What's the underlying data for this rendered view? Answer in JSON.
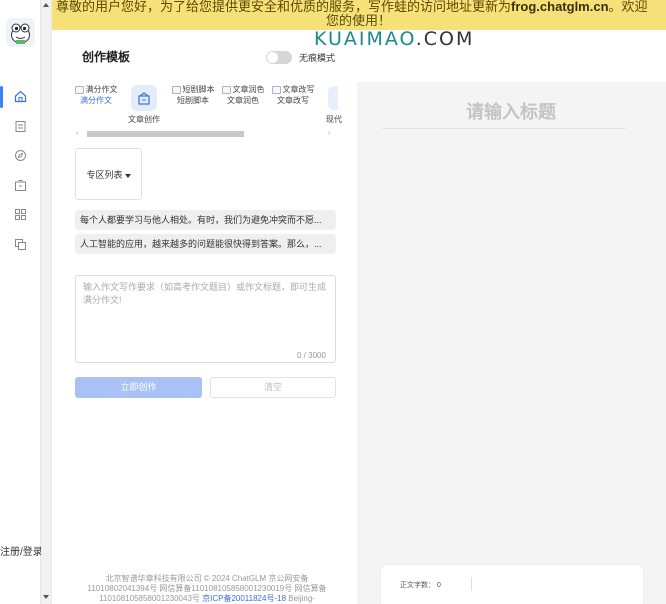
{
  "banner": {
    "text_prefix": "尊敬的用户您好，为了给您提供更安全和优质的服务，写作蛙的访问地址更新为",
    "domain": "frog.chatglm.cn",
    "text_suffix_1": "。欢迎",
    "text_suffix_2": "您的使用！"
  },
  "watermark": {
    "main": "KUAIMAO",
    "suffix": ".COM"
  },
  "sidebar": {
    "items": [
      {
        "icon": "home-icon"
      },
      {
        "icon": "document-icon"
      },
      {
        "icon": "compass-icon"
      },
      {
        "icon": "box-icon"
      },
      {
        "icon": "grid-icon"
      },
      {
        "icon": "copy-icon"
      }
    ],
    "login_label": "注册/登录"
  },
  "header": {
    "title": "创作模板",
    "toggle_label": "无痕模式"
  },
  "templates": [
    {
      "icon_label": "满分作文",
      "label": "满分作文"
    },
    {
      "label": "文章创作"
    },
    {
      "icon_label": "短剧脚本",
      "label": "短剧脚本"
    },
    {
      "icon_label": "文章润色",
      "label": "文章润色"
    },
    {
      "icon_label": "文章改写",
      "label": "文章改写"
    },
    {
      "label": "现代"
    }
  ],
  "zone_select": {
    "label": "专区列表"
  },
  "examples": [
    "每个人都要学习与他人相处。有时，我们为避免冲突而不愿...",
    "人工智能的应用，越来越多的问题能很快得到答案。那么，..."
  ],
  "editor": {
    "placeholder": "输入作文写作要求（如高考作文题目）或作文标题，即可生成满分作文!",
    "counter": "0 / 3000"
  },
  "buttons": {
    "create": "立即创作",
    "clear": "清空"
  },
  "footer": {
    "text": "北京智谱华章科技有限公司 © 2024 ChatGLM 京公网安备11010802041394号 网信算备110108105858001230019号 网信算备110108105858001230043号 ",
    "link": "京ICP备20011824号-18",
    "tail": " Beijing-"
  },
  "output": {
    "title_placeholder": "请输入标题",
    "word_count_label": "正文字数： 0"
  },
  "colors": {
    "accent": "#3b6fd8",
    "banner_bg": "#f5e07a",
    "primary_btn": "#a9c1f5"
  }
}
